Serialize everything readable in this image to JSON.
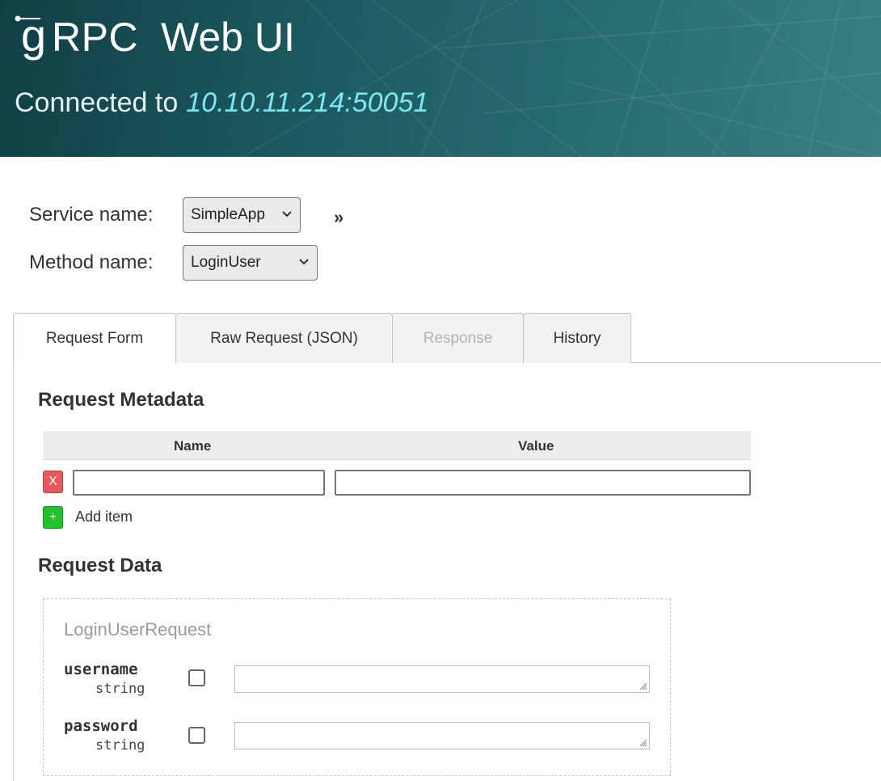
{
  "header": {
    "logo_g": "g",
    "logo_rpc": "RPC",
    "app_title": "Web UI",
    "connected_label": "Connected to",
    "host": "10.10.11.214:50051"
  },
  "selectors": {
    "service_label": "Service name:",
    "service_value": "SimpleApp",
    "method_label": "Method name:",
    "method_value": "LoginUser",
    "expand_glyph": "»"
  },
  "tabs": [
    {
      "label": "Request Form",
      "state": "active"
    },
    {
      "label": "Raw Request (JSON)",
      "state": "normal"
    },
    {
      "label": "Response",
      "state": "disabled"
    },
    {
      "label": "History",
      "state": "normal"
    }
  ],
  "metadata": {
    "title": "Request Metadata",
    "col_name": "Name",
    "col_value": "Value",
    "rows": [
      {
        "name": "",
        "value": ""
      }
    ],
    "delete_glyph": "X",
    "add_glyph": "+",
    "add_label": "Add item"
  },
  "request_data": {
    "title": "Request Data",
    "message_name": "LoginUserRequest",
    "fields": [
      {
        "name": "username",
        "type": "string",
        "value": ""
      },
      {
        "name": "password",
        "type": "string",
        "value": ""
      }
    ]
  },
  "colors": {
    "header_dark": "#113f45",
    "header_light": "#397f82",
    "host_text": "#7fe7f2",
    "delete_red": "#e8585a",
    "add_green": "#22c22e"
  },
  "icons": {
    "logo": "grpc-logo-icon",
    "select_chevron": "chevron-down-icon",
    "expand": "double-chevron-right-icon",
    "delete": "close-icon",
    "add": "plus-icon",
    "resize": "resize-grip-icon"
  }
}
